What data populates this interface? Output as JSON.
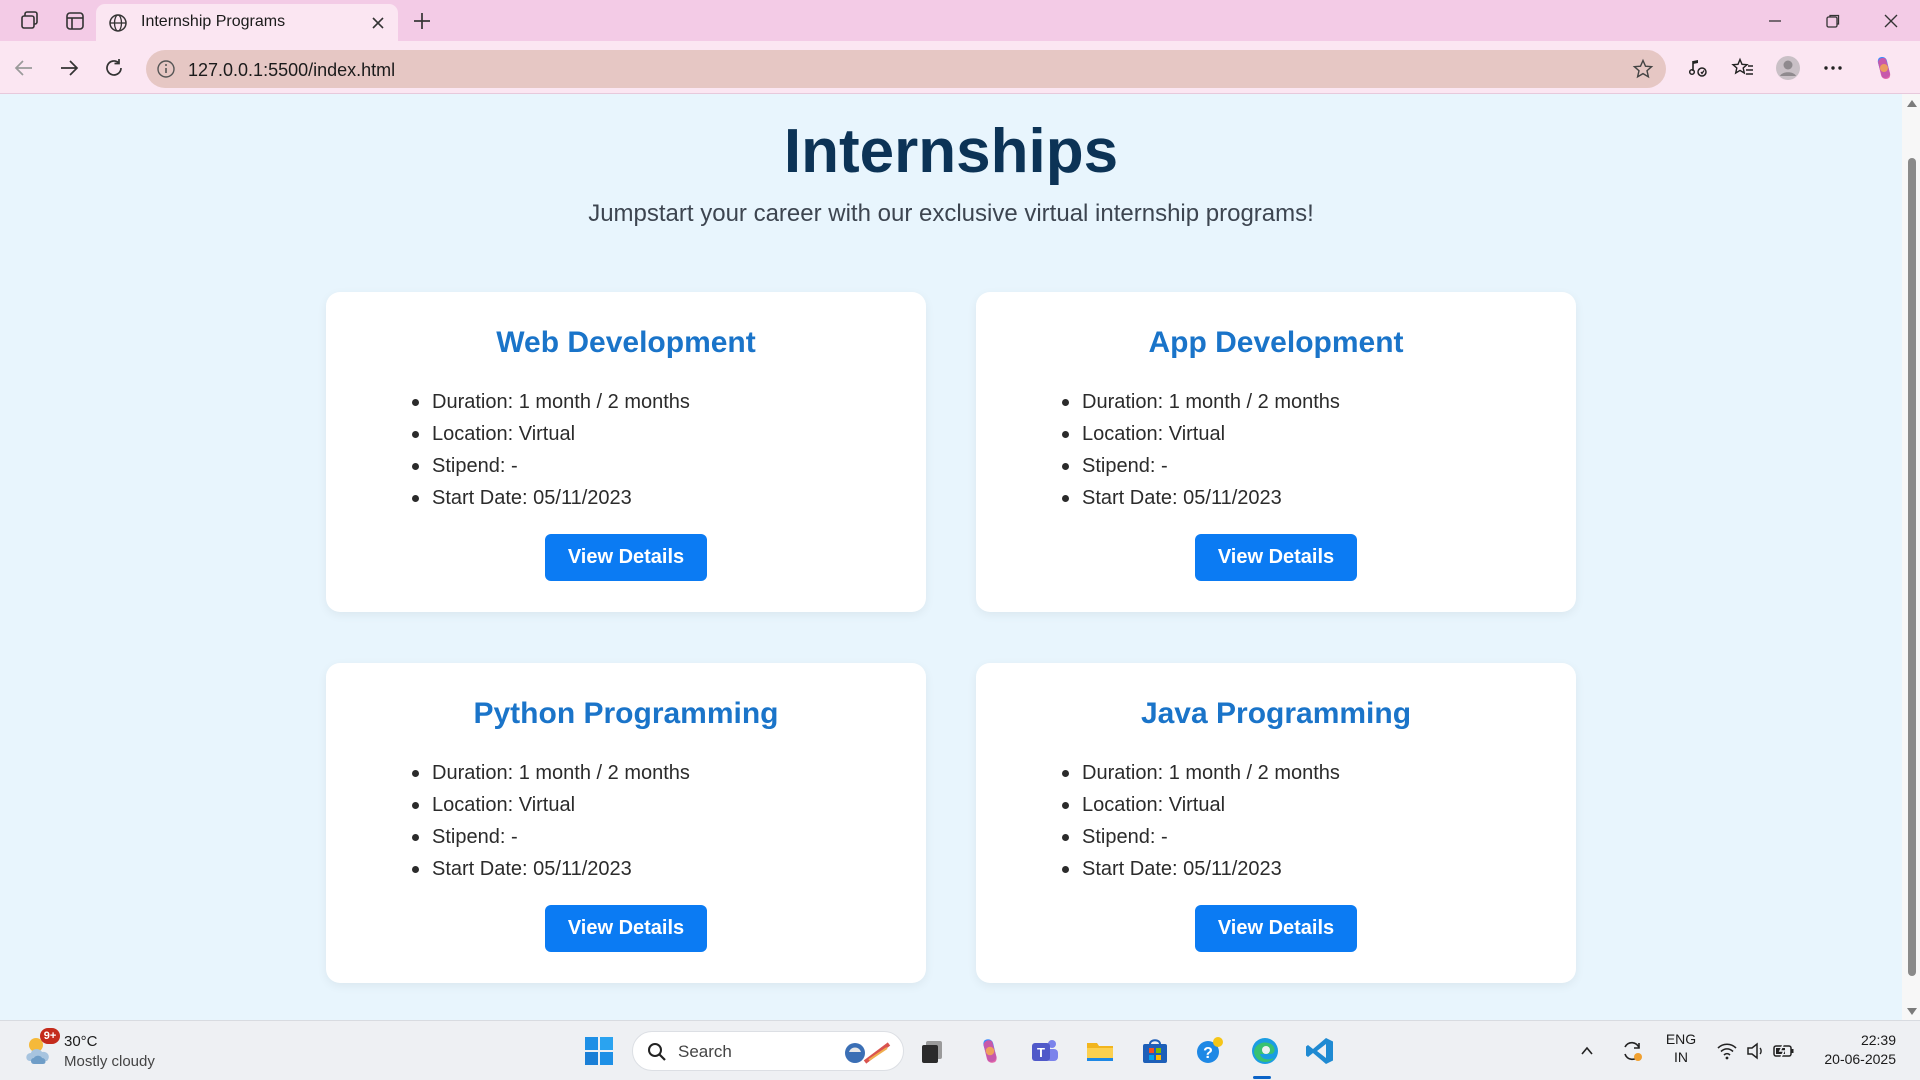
{
  "browser": {
    "tab_title": "Internship Programs",
    "url": "127.0.0.1:5500/index.html"
  },
  "page": {
    "title": "Internships",
    "subtitle": "Jumpstart your career with our exclusive virtual internship programs!"
  },
  "cards": [
    {
      "title": "Web Development",
      "details": [
        "Duration: 1 month / 2 months",
        "Location: Virtual",
        "Stipend: -",
        "Start Date: 05/11/2023"
      ],
      "button": "View Details"
    },
    {
      "title": "App Development",
      "details": [
        "Duration: 1 month / 2 months",
        "Location: Virtual",
        "Stipend: -",
        "Start Date: 05/11/2023"
      ],
      "button": "View Details"
    },
    {
      "title": "Python Programming",
      "details": [
        "Duration: 1 month / 2 months",
        "Location: Virtual",
        "Stipend: -",
        "Start Date: 05/11/2023"
      ],
      "button": "View Details"
    },
    {
      "title": "Java Programming",
      "details": [
        "Duration: 1 month / 2 months",
        "Location: Virtual",
        "Stipend: -",
        "Start Date: 05/11/2023"
      ],
      "button": "View Details"
    }
  ],
  "taskbar": {
    "weather_badge": "9+",
    "temperature": "30°C",
    "weather": "Mostly cloudy",
    "search_label": "Search",
    "language_line1": "ENG",
    "language_line2": "IN",
    "time": "22:39",
    "date": "20-06-2025"
  },
  "colors": {
    "page_background": "#e8f5fd",
    "title": "#0c3356",
    "card_heading": "#1a74c9",
    "button": "#0b7bf3",
    "tabbar": "#f3cbe6"
  },
  "icons": {
    "browser": [
      "workspaces-icon",
      "tab-actions-icon",
      "globe-icon",
      "close-icon",
      "new-tab-icon",
      "minimize-icon",
      "restore-icon",
      "window-close-icon"
    ],
    "toolbar": [
      "back-icon",
      "forward-icon",
      "refresh-icon",
      "info-icon",
      "favorite-star-icon",
      "read-aloud-icon",
      "favorites-icon",
      "profile-icon",
      "more-icon",
      "copilot-icon"
    ],
    "taskbar": [
      "weather-icon",
      "windows-start-icon",
      "search-icon",
      "task-view-icon",
      "copilot-app-icon",
      "teams-icon",
      "file-explorer-icon",
      "store-icon",
      "get-help-icon",
      "edge-icon",
      "vscode-icon",
      "chevron-up-icon",
      "sync-icon",
      "wifi-icon",
      "volume-icon",
      "battery-icon"
    ]
  }
}
